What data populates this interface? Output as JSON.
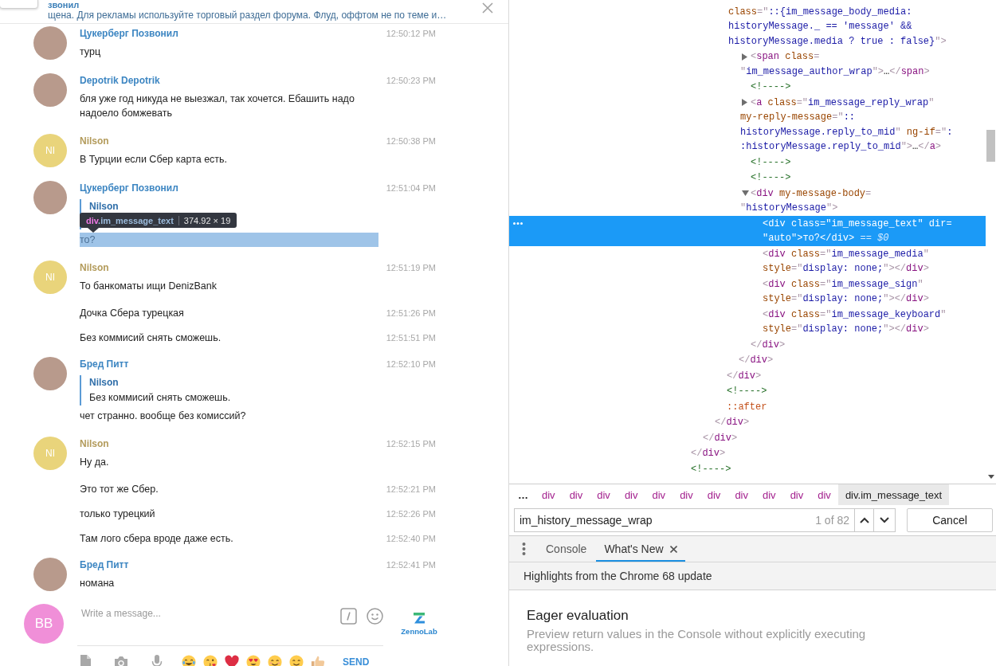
{
  "chat": {
    "pinned": {
      "title": "звонил",
      "text": "щена. Для рекламы используйте торговый раздел форума. Флуд, оффтом не по теме и…"
    },
    "messages": [
      {
        "kind": "head",
        "author": {
          "name": "Цукерберг Позвонил",
          "color": "#3d86c2"
        },
        "avatar": {
          "kind": "photo"
        },
        "time": "12:50:12 PM",
        "text": "турц",
        "highlighted": false
      },
      {
        "kind": "head",
        "author": {
          "name": "Depotrik Depotrik",
          "color": "#3d86c2"
        },
        "avatar": {
          "kind": "photo"
        },
        "time": "12:50:23 PM",
        "text": "бля уже год никуда не выезжал, так хочется. Ебашить надо надоело бомжевать",
        "highlighted": false
      },
      {
        "kind": "head",
        "author": {
          "name": "Nilson",
          "color": "#b39b5b"
        },
        "avatar": {
          "kind": "initials",
          "initials": "NI",
          "color": "#e9d47b"
        },
        "time": "12:50:38 PM",
        "text": "В Турции если Сбер карта есть.",
        "highlighted": false
      },
      {
        "kind": "head",
        "author": {
          "name": "Цукерберг Позвонил",
          "color": "#3d86c2"
        },
        "avatar": {
          "kind": "photo"
        },
        "time": "12:51:04 PM",
        "reply": {
          "author": "Nilson"
        },
        "text": "то?",
        "highlighted": true,
        "tooltip": {
          "tag": "div",
          "class_name": ".im_message_text",
          "size": "374.92 × 19"
        }
      },
      {
        "kind": "head",
        "author": {
          "name": "Nilson",
          "color": "#b39b5b"
        },
        "avatar": {
          "kind": "initials",
          "initials": "NI",
          "color": "#e9d47b"
        },
        "time": "12:51:19 PM",
        "text": "То банкоматы ищи DenizBank",
        "highlighted": false
      },
      {
        "kind": "follow",
        "time": "12:51:26 PM",
        "text": "Дочка Сбера турецкая",
        "highlighted": false
      },
      {
        "kind": "follow",
        "time": "12:51:51 PM",
        "text": "Без коммисий снять сможешь.",
        "highlighted": false
      },
      {
        "kind": "head",
        "author": {
          "name": "Бред Питт",
          "color": "#3d86c2"
        },
        "avatar": {
          "kind": "photo"
        },
        "time": "12:52:10 PM",
        "reply": {
          "author": "Nilson",
          "text": "Без коммисий снять сможешь."
        },
        "text": "чет странно. вообще без комиссий?",
        "highlighted": false
      },
      {
        "kind": "head",
        "author": {
          "name": "Nilson",
          "color": "#b39b5b"
        },
        "avatar": {
          "kind": "initials",
          "initials": "NI",
          "color": "#e9d47b"
        },
        "time": "12:52:15 PM",
        "text": "Ну да.",
        "highlighted": false
      },
      {
        "kind": "follow",
        "time": "12:52:21 PM",
        "text": "Это тот же Сбер.",
        "highlighted": false
      },
      {
        "kind": "follow",
        "time": "12:52:26 PM",
        "text": "только турецкий",
        "highlighted": false
      },
      {
        "kind": "follow",
        "time": "12:52:40 PM",
        "text": "Там лого сбера вроде даже есть.",
        "highlighted": false
      },
      {
        "kind": "head",
        "author": {
          "name": "Бред Питт",
          "color": "#3d86c2"
        },
        "avatar": {
          "kind": "photo"
        },
        "time": "12:52:41 PM",
        "text": "номана",
        "highlighted": false
      }
    ],
    "composer": {
      "avatar": {
        "initials": "BB",
        "color": "#f08fd8"
      },
      "placeholder": "Write a message...",
      "send_label": "SEND",
      "logo_text": "ZennoLab"
    }
  },
  "elements_panel": {
    "tree": [
      {
        "closing": [
          {
            "text": "</",
            "kind": "bracket"
          },
          {
            "text": "div",
            "kind": "tag"
          },
          {
            "text": ">",
            "kind": "bracket"
          }
        ],
        "children": [
          {
            "closing": [
              {
                "text": "</",
                "kind": "bracket"
              },
              {
                "text": "div",
                "kind": "tag"
              },
              {
                "text": ">",
                "kind": "bracket"
              }
            ],
            "children": [
              {
                "closing": [
                  {
                    "text": "</",
                    "kind": "bracket"
                  },
                  {
                    "text": "div",
                    "kind": "tag"
                  },
                  {
                    "text": ">",
                    "kind": "bracket"
                  }
                ],
                "children": [
                  {
                    "closing": [
                      {
                        "text": "</",
                        "kind": "bracket"
                      },
                      {
                        "text": "div",
                        "kind": "tag"
                      },
                      {
                        "text": ">",
                        "kind": "bracket"
                      }
                    ],
                    "children": [
                      {
                        "lines": [
                          [
                            {
                              "text": "class",
                              "kind": "attr"
                            },
                            {
                              "text": "=\"",
                              "kind": "bracket"
                            },
                            {
                              "text": "::{im_message_body_media:",
                              "kind": "value"
                            }
                          ],
                          [
                            {
                              "text": "historyMessage._ == 'message' &&",
                              "kind": "value"
                            }
                          ],
                          [
                            {
                              "text": "historyMessage.media ? true : false}",
                              "kind": "value"
                            },
                            {
                              "text": "\">",
                              "kind": "bracket"
                            }
                          ]
                        ],
                        "selected": false,
                        "children": [
                          {
                            "lines": [
                              [
                                {
                                  "text": "<",
                                  "kind": "bracket"
                                },
                                {
                                  "text": "span",
                                  "kind": "tag"
                                },
                                {
                                  "text": " class",
                                  "kind": "attr"
                                },
                                {
                                  "text": "=",
                                  "kind": "bracket"
                                }
                              ],
                              [
                                {
                                  "text": "\"",
                                  "kind": "bracket"
                                },
                                {
                                  "text": "im_message_author_wrap",
                                  "kind": "value"
                                },
                                {
                                  "text": "\">",
                                  "kind": "bracket"
                                },
                                {
                                  "text": "…",
                                  "kind": "plain"
                                },
                                {
                                  "text": "</",
                                  "kind": "bracket"
                                },
                                {
                                  "text": "span",
                                  "kind": "tag"
                                },
                                {
                                  "text": ">",
                                  "kind": "bracket"
                                }
                              ]
                            ],
                            "expanded": false,
                            "selected": false
                          },
                          {
                            "lines": [
                              [
                                {
                                  "text": "<!---->",
                                  "kind": "comment"
                                }
                              ]
                            ],
                            "selected": false
                          },
                          {
                            "lines": [
                              [
                                {
                                  "text": "<",
                                  "kind": "bracket"
                                },
                                {
                                  "text": "a",
                                  "kind": "tag"
                                },
                                {
                                  "text": " class",
                                  "kind": "attr"
                                },
                                {
                                  "text": "=\"",
                                  "kind": "bracket"
                                },
                                {
                                  "text": "im_message_reply_wrap",
                                  "kind": "value"
                                },
                                {
                                  "text": "\"",
                                  "kind": "bracket"
                                }
                              ],
                              [
                                {
                                  "text": "my-reply-message",
                                  "kind": "attr"
                                },
                                {
                                  "text": "=\"",
                                  "kind": "bracket"
                                },
                                {
                                  "text": "::",
                                  "kind": "value"
                                }
                              ],
                              [
                                {
                                  "text": "historyMessage.reply_to_mid",
                                  "kind": "value"
                                },
                                {
                                  "text": "\"",
                                  "kind": "bracket"
                                },
                                {
                                  "text": " ng-if",
                                  "kind": "attr"
                                },
                                {
                                  "text": "=\"",
                                  "kind": "bracket"
                                },
                                {
                                  "text": ":",
                                  "kind": "value"
                                }
                              ],
                              [
                                {
                                  "text": ":historyMessage.reply_to_mid",
                                  "kind": "value"
                                },
                                {
                                  "text": "\">",
                                  "kind": "bracket"
                                },
                                {
                                  "text": "…",
                                  "kind": "plain"
                                },
                                {
                                  "text": "</",
                                  "kind": "bracket"
                                },
                                {
                                  "text": "a",
                                  "kind": "tag"
                                },
                                {
                                  "text": ">",
                                  "kind": "bracket"
                                }
                              ]
                            ],
                            "expanded": false,
                            "selected": false
                          },
                          {
                            "lines": [
                              [
                                {
                                  "text": "<!---->",
                                  "kind": "comment"
                                }
                              ]
                            ],
                            "selected": false
                          },
                          {
                            "lines": [
                              [
                                {
                                  "text": "<!---->",
                                  "kind": "comment"
                                }
                              ]
                            ],
                            "selected": false
                          },
                          {
                            "lines": [
                              [
                                {
                                  "text": "<",
                                  "kind": "bracket"
                                },
                                {
                                  "text": "div",
                                  "kind": "tag"
                                },
                                {
                                  "text": " my-message-body",
                                  "kind": "attr"
                                },
                                {
                                  "text": "=",
                                  "kind": "bracket"
                                }
                              ],
                              [
                                {
                                  "text": "\"",
                                  "kind": "bracket"
                                },
                                {
                                  "text": "historyMessage",
                                  "kind": "value"
                                },
                                {
                                  "text": "\">",
                                  "kind": "bracket"
                                }
                              ]
                            ],
                            "expanded": true,
                            "selected": false,
                            "children": [
                              {
                                "lines": [
                                  [
                                    {
                                      "text": "<",
                                      "kind": "bracket"
                                    },
                                    {
                                      "text": "div",
                                      "kind": "tag"
                                    },
                                    {
                                      "text": " class",
                                      "kind": "attr"
                                    },
                                    {
                                      "text": "=\"",
                                      "kind": "bracket"
                                    },
                                    {
                                      "text": "im_message_text",
                                      "kind": "value"
                                    },
                                    {
                                      "text": "\"",
                                      "kind": "bracket"
                                    },
                                    {
                                      "text": " dir",
                                      "kind": "attr"
                                    },
                                    {
                                      "text": "=",
                                      "kind": "bracket"
                                    }
                                  ],
                                  [
                                    {
                                      "text": "\"",
                                      "kind": "bracket"
                                    },
                                    {
                                      "text": "auto",
                                      "kind": "value"
                                    },
                                    {
                                      "text": "\">",
                                      "kind": "bracket"
                                    },
                                    {
                                      "text": "то?",
                                      "kind": "plain"
                                    },
                                    {
                                      "text": "</",
                                      "kind": "bracket"
                                    },
                                    {
                                      "text": "div",
                                      "kind": "tag"
                                    },
                                    {
                                      "text": ">",
                                      "kind": "bracket"
                                    },
                                    {
                                      "text": " == $0",
                                      "kind": "hint"
                                    }
                                  ]
                                ],
                                "selected": true
                              },
                              {
                                "lines": [
                                  [
                                    {
                                      "text": "<",
                                      "kind": "bracket"
                                    },
                                    {
                                      "text": "div",
                                      "kind": "tag"
                                    },
                                    {
                                      "text": " class",
                                      "kind": "attr"
                                    },
                                    {
                                      "text": "=\"",
                                      "kind": "bracket"
                                    },
                                    {
                                      "text": "im_message_media",
                                      "kind": "value"
                                    },
                                    {
                                      "text": "\"",
                                      "kind": "bracket"
                                    }
                                  ],
                                  [
                                    {
                                      "text": "style",
                                      "kind": "attr"
                                    },
                                    {
                                      "text": "=\"",
                                      "kind": "bracket"
                                    },
                                    {
                                      "text": "display: none;",
                                      "kind": "value"
                                    },
                                    {
                                      "text": "\"></",
                                      "kind": "bracket"
                                    },
                                    {
                                      "text": "div",
                                      "kind": "tag"
                                    },
                                    {
                                      "text": ">",
                                      "kind": "bracket"
                                    }
                                  ]
                                ],
                                "selected": false
                              },
                              {
                                "lines": [
                                  [
                                    {
                                      "text": "<",
                                      "kind": "bracket"
                                    },
                                    {
                                      "text": "div",
                                      "kind": "tag"
                                    },
                                    {
                                      "text": " class",
                                      "kind": "attr"
                                    },
                                    {
                                      "text": "=\"",
                                      "kind": "bracket"
                                    },
                                    {
                                      "text": "im_message_sign",
                                      "kind": "value"
                                    },
                                    {
                                      "text": "\"",
                                      "kind": "bracket"
                                    }
                                  ],
                                  [
                                    {
                                      "text": "style",
                                      "kind": "attr"
                                    },
                                    {
                                      "text": "=\"",
                                      "kind": "bracket"
                                    },
                                    {
                                      "text": "display: none;",
                                      "kind": "value"
                                    },
                                    {
                                      "text": "\"></",
                                      "kind": "bracket"
                                    },
                                    {
                                      "text": "div",
                                      "kind": "tag"
                                    },
                                    {
                                      "text": ">",
                                      "kind": "bracket"
                                    }
                                  ]
                                ],
                                "selected": false
                              },
                              {
                                "lines": [
                                  [
                                    {
                                      "text": "<",
                                      "kind": "bracket"
                                    },
                                    {
                                      "text": "div",
                                      "kind": "tag"
                                    },
                                    {
                                      "text": " class",
                                      "kind": "attr"
                                    },
                                    {
                                      "text": "=\"",
                                      "kind": "bracket"
                                    },
                                    {
                                      "text": "im_message_keyboard",
                                      "kind": "value"
                                    },
                                    {
                                      "text": "\"",
                                      "kind": "bracket"
                                    }
                                  ],
                                  [
                                    {
                                      "text": "style",
                                      "kind": "attr"
                                    },
                                    {
                                      "text": "=\"",
                                      "kind": "bracket"
                                    },
                                    {
                                      "text": "display: none;",
                                      "kind": "value"
                                    },
                                    {
                                      "text": "\"></",
                                      "kind": "bracket"
                                    },
                                    {
                                      "text": "div",
                                      "kind": "tag"
                                    },
                                    {
                                      "text": ">",
                                      "kind": "bracket"
                                    }
                                  ]
                                ],
                                "selected": false
                              }
                            ],
                            "closing": [
                              {
                                "text": "</",
                                "kind": "bracket"
                              },
                              {
                                "text": "div",
                                "kind": "tag"
                              },
                              {
                                "text": ">",
                                "kind": "bracket"
                              }
                            ]
                          }
                        ],
                        "closing": [
                          {
                            "text": "</",
                            "kind": "bracket"
                          },
                          {
                            "text": "div",
                            "kind": "tag"
                          },
                          {
                            "text": ">",
                            "kind": "bracket"
                          }
                        ]
                      }
                    ]
                  },
                  {
                    "lines": [
                      [
                        {
                          "text": "<!---->",
                          "kind": "comment"
                        }
                      ]
                    ],
                    "selected": false
                  },
                  {
                    "lines": [
                      [
                        {
                          "text": "::after",
                          "kind": "pseudo"
                        }
                      ]
                    ],
                    "selected": false
                  }
                ]
              }
            ]
          }
        ]
      },
      {
        "lines": [
          [
            {
              "text": "<!---->",
              "kind": "comment"
            }
          ]
        ],
        "selected": false
      }
    ],
    "breadcrumbs": {
      "overflow": "…",
      "items": [
        {
          "label": "div",
          "selected": false
        },
        {
          "label": "div",
          "selected": false
        },
        {
          "label": "div",
          "selected": false
        },
        {
          "label": "div",
          "selected": false
        },
        {
          "label": "div",
          "selected": false
        },
        {
          "label": "div",
          "selected": false
        },
        {
          "label": "div",
          "selected": false
        },
        {
          "label": "div",
          "selected": false
        },
        {
          "label": "div",
          "selected": false
        },
        {
          "label": "div",
          "selected": false
        },
        {
          "label": "div",
          "selected": false
        },
        {
          "label": "div.im_message_text",
          "selected": true
        }
      ]
    },
    "search": {
      "value": "im_history_message_wrap",
      "match_count": "1 of 82",
      "cancel_label": "Cancel"
    }
  },
  "drawer": {
    "tabs": [
      {
        "label": "Console",
        "selected": false,
        "closable": false
      },
      {
        "label": "What's New",
        "selected": true,
        "closable": true
      }
    ],
    "subtitle": "Highlights from the Chrome 68 update",
    "feature": {
      "title": "Eager evaluation",
      "description": "Preview return values in the Console without explicitly executing expressions."
    }
  }
}
